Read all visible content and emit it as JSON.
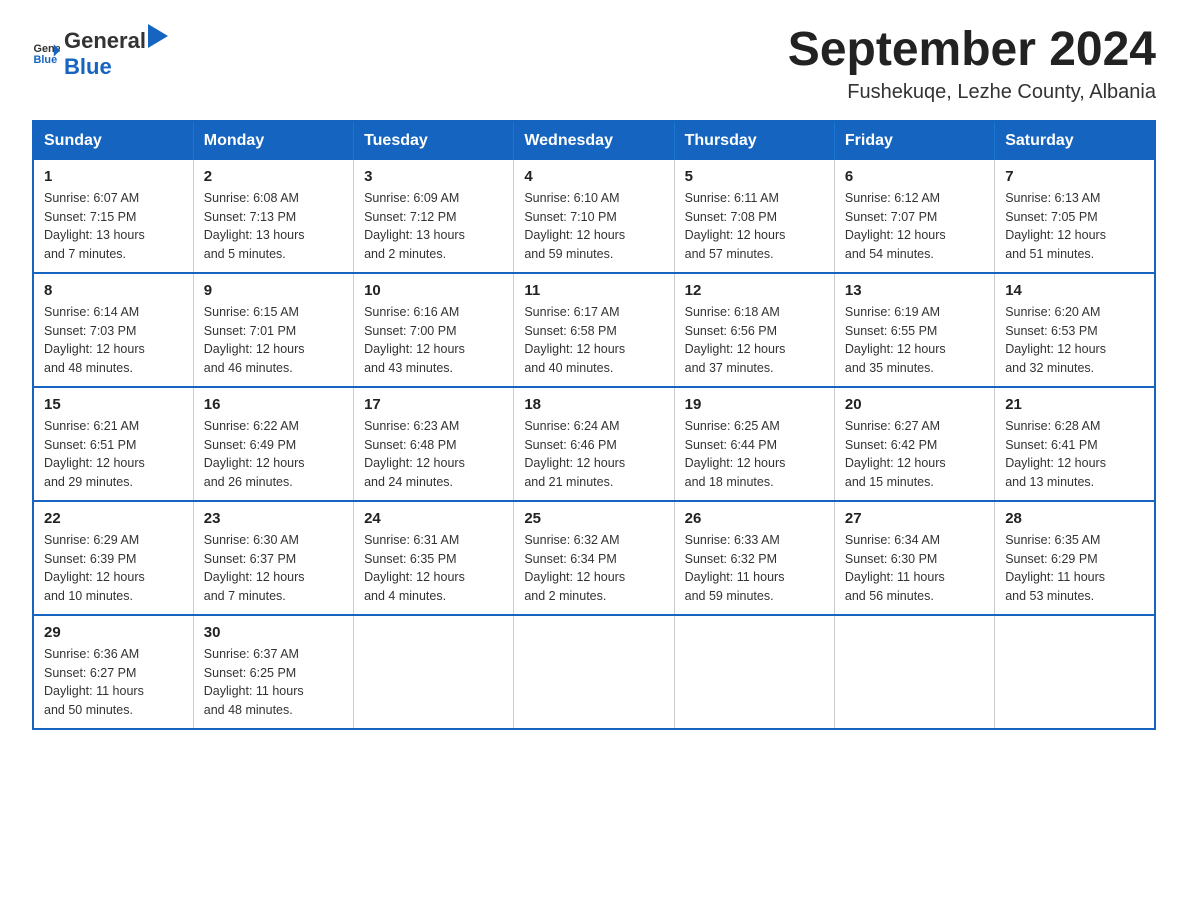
{
  "header": {
    "logo_general": "General",
    "logo_blue": "Blue",
    "title": "September 2024",
    "subtitle": "Fushekuqe, Lezhe County, Albania"
  },
  "weekdays": [
    "Sunday",
    "Monday",
    "Tuesday",
    "Wednesday",
    "Thursday",
    "Friday",
    "Saturday"
  ],
  "weeks": [
    [
      {
        "day": "1",
        "sunrise": "6:07 AM",
        "sunset": "7:15 PM",
        "daylight": "13 hours and 7 minutes."
      },
      {
        "day": "2",
        "sunrise": "6:08 AM",
        "sunset": "7:13 PM",
        "daylight": "13 hours and 5 minutes."
      },
      {
        "day": "3",
        "sunrise": "6:09 AM",
        "sunset": "7:12 PM",
        "daylight": "13 hours and 2 minutes."
      },
      {
        "day": "4",
        "sunrise": "6:10 AM",
        "sunset": "7:10 PM",
        "daylight": "12 hours and 59 minutes."
      },
      {
        "day": "5",
        "sunrise": "6:11 AM",
        "sunset": "7:08 PM",
        "daylight": "12 hours and 57 minutes."
      },
      {
        "day": "6",
        "sunrise": "6:12 AM",
        "sunset": "7:07 PM",
        "daylight": "12 hours and 54 minutes."
      },
      {
        "day": "7",
        "sunrise": "6:13 AM",
        "sunset": "7:05 PM",
        "daylight": "12 hours and 51 minutes."
      }
    ],
    [
      {
        "day": "8",
        "sunrise": "6:14 AM",
        "sunset": "7:03 PM",
        "daylight": "12 hours and 48 minutes."
      },
      {
        "day": "9",
        "sunrise": "6:15 AM",
        "sunset": "7:01 PM",
        "daylight": "12 hours and 46 minutes."
      },
      {
        "day": "10",
        "sunrise": "6:16 AM",
        "sunset": "7:00 PM",
        "daylight": "12 hours and 43 minutes."
      },
      {
        "day": "11",
        "sunrise": "6:17 AM",
        "sunset": "6:58 PM",
        "daylight": "12 hours and 40 minutes."
      },
      {
        "day": "12",
        "sunrise": "6:18 AM",
        "sunset": "6:56 PM",
        "daylight": "12 hours and 37 minutes."
      },
      {
        "day": "13",
        "sunrise": "6:19 AM",
        "sunset": "6:55 PM",
        "daylight": "12 hours and 35 minutes."
      },
      {
        "day": "14",
        "sunrise": "6:20 AM",
        "sunset": "6:53 PM",
        "daylight": "12 hours and 32 minutes."
      }
    ],
    [
      {
        "day": "15",
        "sunrise": "6:21 AM",
        "sunset": "6:51 PM",
        "daylight": "12 hours and 29 minutes."
      },
      {
        "day": "16",
        "sunrise": "6:22 AM",
        "sunset": "6:49 PM",
        "daylight": "12 hours and 26 minutes."
      },
      {
        "day": "17",
        "sunrise": "6:23 AM",
        "sunset": "6:48 PM",
        "daylight": "12 hours and 24 minutes."
      },
      {
        "day": "18",
        "sunrise": "6:24 AM",
        "sunset": "6:46 PM",
        "daylight": "12 hours and 21 minutes."
      },
      {
        "day": "19",
        "sunrise": "6:25 AM",
        "sunset": "6:44 PM",
        "daylight": "12 hours and 18 minutes."
      },
      {
        "day": "20",
        "sunrise": "6:27 AM",
        "sunset": "6:42 PM",
        "daylight": "12 hours and 15 minutes."
      },
      {
        "day": "21",
        "sunrise": "6:28 AM",
        "sunset": "6:41 PM",
        "daylight": "12 hours and 13 minutes."
      }
    ],
    [
      {
        "day": "22",
        "sunrise": "6:29 AM",
        "sunset": "6:39 PM",
        "daylight": "12 hours and 10 minutes."
      },
      {
        "day": "23",
        "sunrise": "6:30 AM",
        "sunset": "6:37 PM",
        "daylight": "12 hours and 7 minutes."
      },
      {
        "day": "24",
        "sunrise": "6:31 AM",
        "sunset": "6:35 PM",
        "daylight": "12 hours and 4 minutes."
      },
      {
        "day": "25",
        "sunrise": "6:32 AM",
        "sunset": "6:34 PM",
        "daylight": "12 hours and 2 minutes."
      },
      {
        "day": "26",
        "sunrise": "6:33 AM",
        "sunset": "6:32 PM",
        "daylight": "11 hours and 59 minutes."
      },
      {
        "day": "27",
        "sunrise": "6:34 AM",
        "sunset": "6:30 PM",
        "daylight": "11 hours and 56 minutes."
      },
      {
        "day": "28",
        "sunrise": "6:35 AM",
        "sunset": "6:29 PM",
        "daylight": "11 hours and 53 minutes."
      }
    ],
    [
      {
        "day": "29",
        "sunrise": "6:36 AM",
        "sunset": "6:27 PM",
        "daylight": "11 hours and 50 minutes."
      },
      {
        "day": "30",
        "sunrise": "6:37 AM",
        "sunset": "6:25 PM",
        "daylight": "11 hours and 48 minutes."
      },
      null,
      null,
      null,
      null,
      null
    ]
  ],
  "labels": {
    "sunrise": "Sunrise:",
    "sunset": "Sunset:",
    "daylight": "Daylight:"
  }
}
